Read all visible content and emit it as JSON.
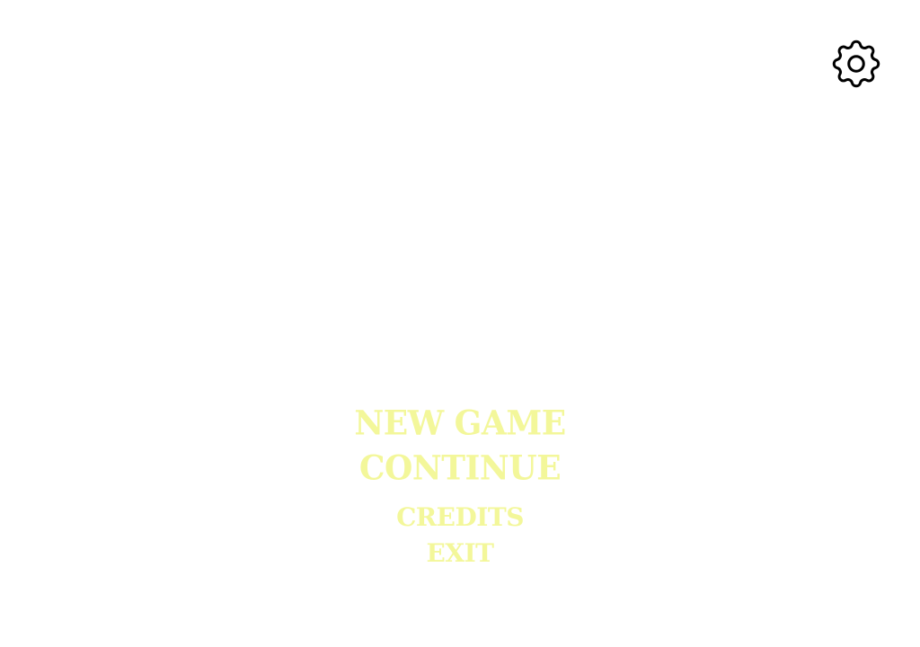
{
  "settings": {
    "icon": "gear-icon",
    "color": "#000000"
  },
  "menu": {
    "text_color": "#f3f79a",
    "new_game": "NEW GAME",
    "continue": "CONTINUE",
    "credits": "CREDITS",
    "exit": "EXIT"
  }
}
